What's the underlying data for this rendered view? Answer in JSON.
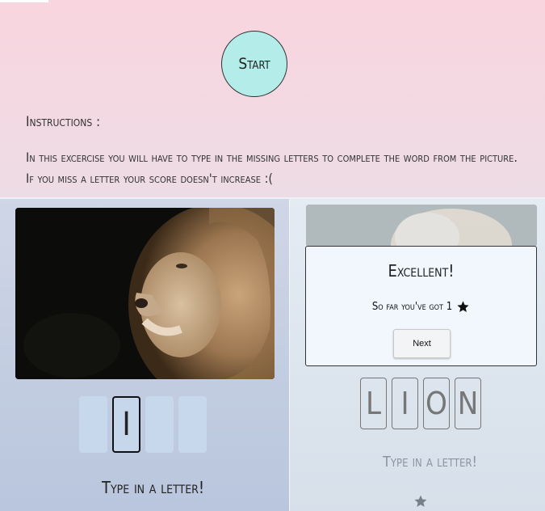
{
  "start_button": {
    "label": "Start"
  },
  "instructions": {
    "title": "Instructions :",
    "line1": "In this excercise you will have to type in the missing letters to complete the word from the picture.",
    "line2": "If you miss a letter your score doesn't increase :("
  },
  "left_panel": {
    "image": "lion-photo",
    "letters": [
      "",
      "I",
      "",
      ""
    ],
    "prompt": "Type in a letter!"
  },
  "right_panel": {
    "image": "lion-photo",
    "letters": [
      "L",
      "I",
      "O",
      "N"
    ],
    "prompt": "Type in a letter!",
    "score_stars": 1
  },
  "modal": {
    "title": "Excellent!",
    "message": "So far you've got 1",
    "next_label": "Next"
  },
  "colors": {
    "start_button": "#b3ece8",
    "letter_box": "#c8d8ec",
    "modal_bg": "#f1f7fd"
  }
}
